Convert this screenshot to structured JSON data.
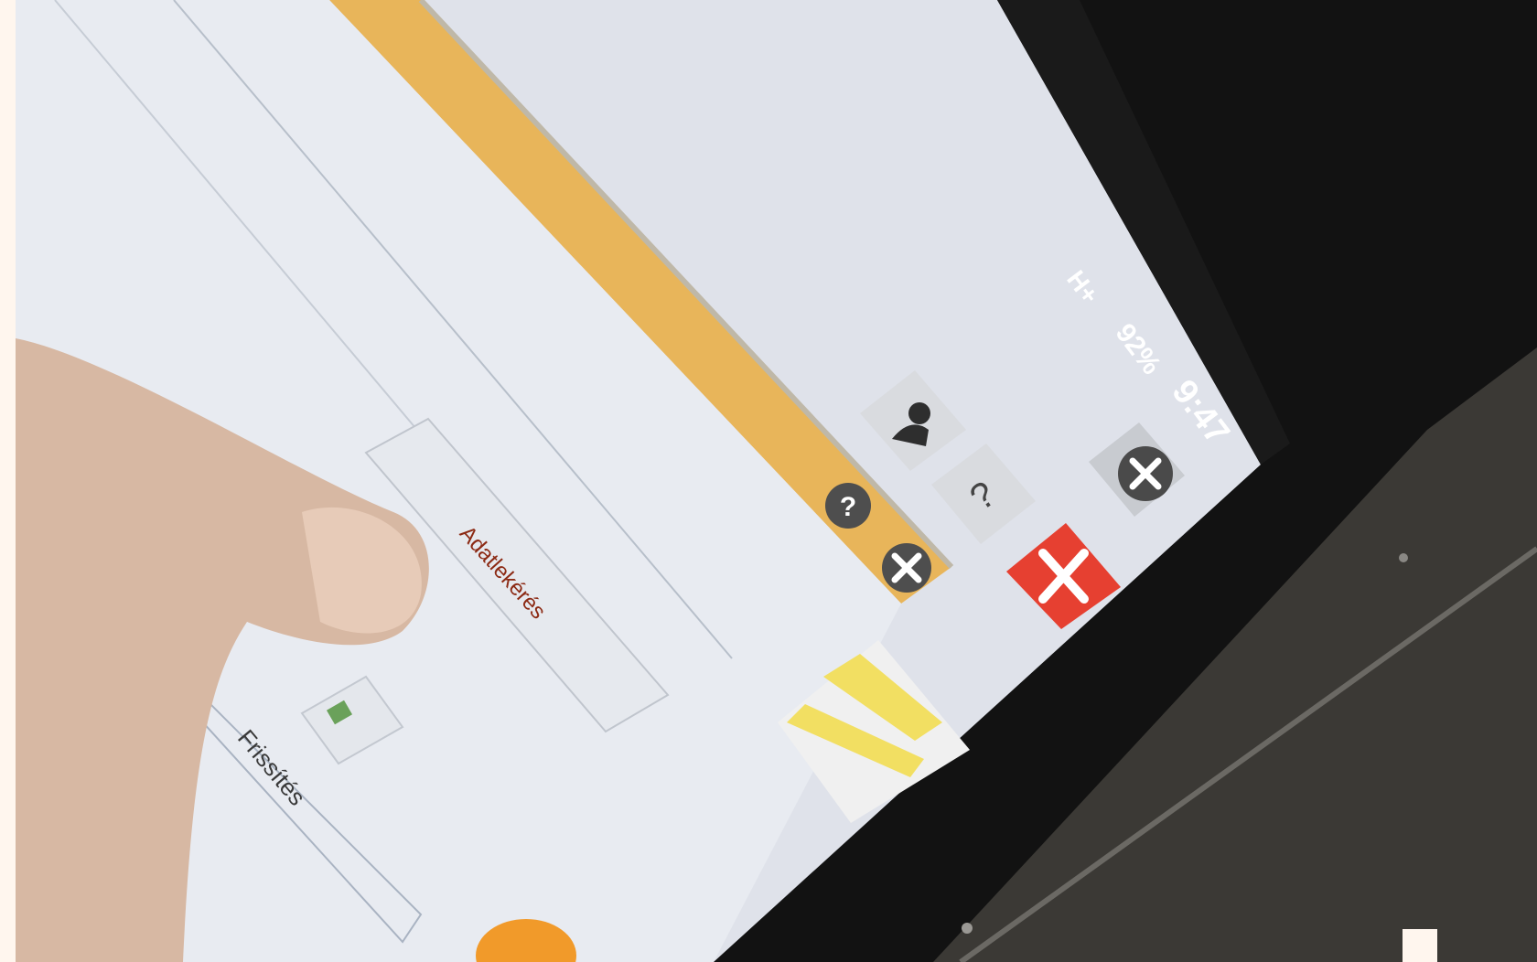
{
  "status_bar": {
    "network": "H+",
    "battery": "92%",
    "time": "9:47"
  },
  "panel": {
    "query_button_label": "Adatlekérés",
    "refresh_label": "Frissítés"
  },
  "icons": {
    "help": "question-icon",
    "close": "close-icon",
    "user": "user-icon",
    "toolbar_help": "question-icon",
    "exit": "exit-icon",
    "refresh": "refresh-icon"
  },
  "colors": {
    "title_bar": "#e8b55a",
    "exit_red": "#e64031",
    "query_text": "#8c2a14",
    "map_yellow": "#f2df62",
    "orange_blob": "#f19a2a"
  }
}
